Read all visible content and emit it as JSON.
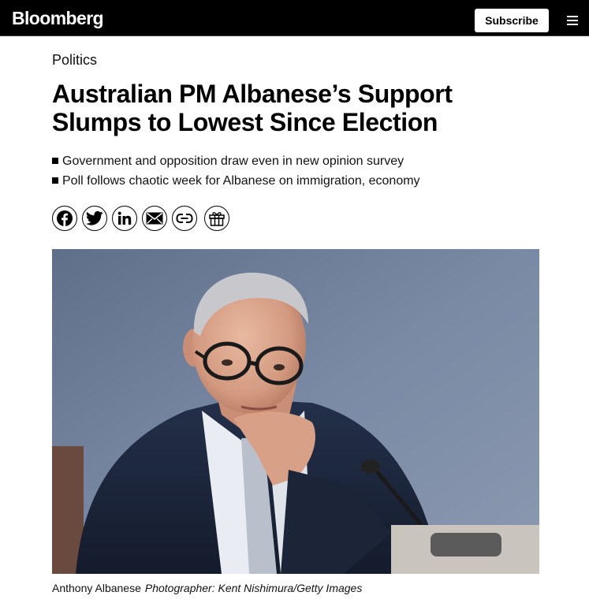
{
  "header": {
    "logo_text": "Bloomberg",
    "subscribe_label": "Subscribe",
    "menu_icon": "hamburger-menu-icon"
  },
  "article": {
    "section": "Politics",
    "headline": "Australian PM Albanese’s Support Slumps to Lowest Since Election",
    "bullets": [
      "Government and opposition draw even in new opinion survey",
      "Poll follows chaotic week for Albanese on immigration, economy"
    ],
    "share_icons": [
      "facebook-icon",
      "twitter-icon",
      "linkedin-icon",
      "email-icon",
      "link-icon",
      "gift-icon"
    ],
    "image_caption": "Anthony Albanese",
    "image_credit": "Photographer: Kent Nishimura/Getty Images"
  },
  "colors": {
    "header_background": "#000000",
    "page_background": "#ffffff",
    "text": "#000000",
    "photo_background": "#6f7f98"
  }
}
